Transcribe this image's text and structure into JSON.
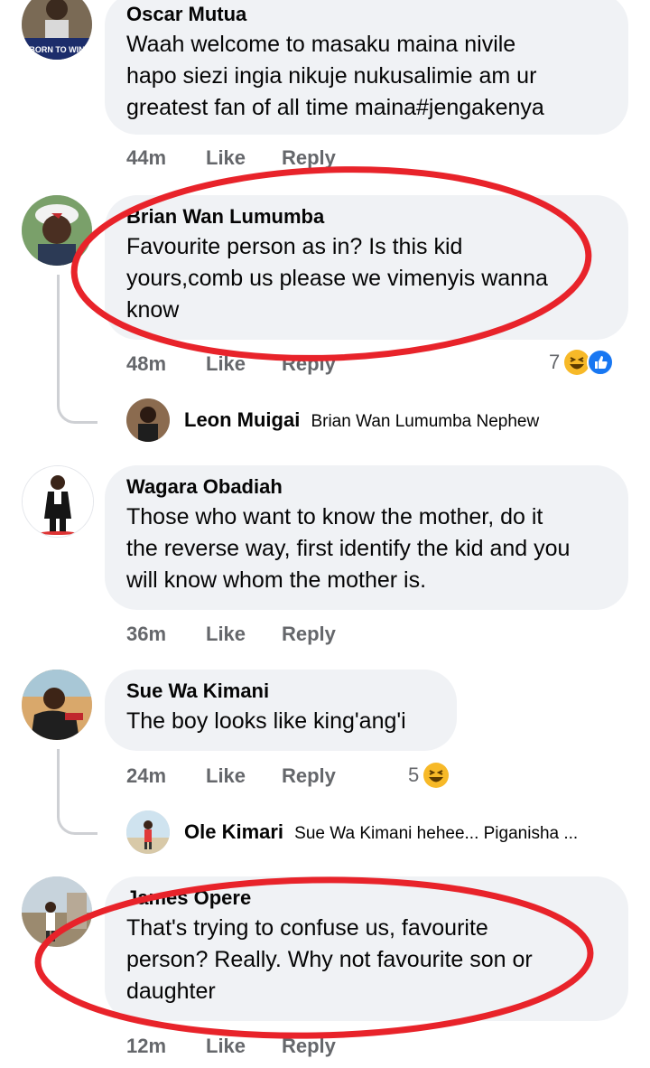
{
  "colors": {
    "bubble": "#f0f2f5",
    "meta": "#65676b",
    "ring": "#e8232a",
    "like_blue": "#1877f2",
    "haha_yellow": "#f7b928"
  },
  "comments": [
    {
      "name": "Oscar Mutua",
      "lines": [
        "Waah welcome to masaku maina nivile",
        "hapo siezi ingia nikuje nukusalimie am ur",
        "greatest fan of all time maina#jengakenya"
      ],
      "time": "44m",
      "like": "Like",
      "reply": "Reply",
      "avatar_text": "BORN TO WIN"
    },
    {
      "name": "Brian Wan Lumumba",
      "lines": [
        "Favourite person as in? Is this kid",
        "yours,comb us please we vimenyis wanna",
        "know"
      ],
      "time": "48m",
      "like": "Like",
      "reply": "Reply",
      "reaction_count": "7",
      "reaction_icons": [
        "haha-icon",
        "like-icon"
      ]
    },
    {
      "name": "Wagara Obadiah",
      "lines": [
        "Those who want to know the mother, do it",
        "the reverse way, first identify the kid and you",
        "will know whom the mother is."
      ],
      "time": "36m",
      "like": "Like",
      "reply": "Reply"
    },
    {
      "name": "Sue Wa Kimani",
      "lines": [
        "The boy looks like king'ang'i"
      ],
      "time": "24m",
      "like": "Like",
      "reply": "Reply",
      "reaction_count": "5",
      "reaction_icons": [
        "haha-icon"
      ]
    },
    {
      "name": "James Opere",
      "lines": [
        "That's trying to confuse us, favourite",
        "person? Really. Why not favourite son or",
        "daughter"
      ],
      "time": "12m",
      "like": "Like",
      "reply": "Reply"
    }
  ],
  "replies": [
    {
      "name": "Leon Muigai",
      "text": "Brian Wan Lumumba Nephew"
    },
    {
      "name": "Ole Kimari",
      "text": "Sue Wa Kimani hehee... Piganisha ..."
    }
  ]
}
